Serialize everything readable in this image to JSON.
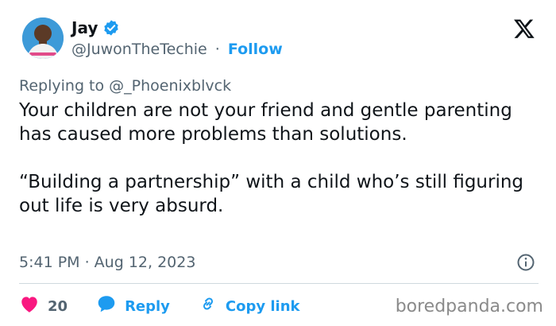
{
  "author": {
    "name": "Jay",
    "handle": "@JuwonTheTechie",
    "separator": "·",
    "follow_label": "Follow",
    "verified": true
  },
  "reply_context": {
    "prefix": "Replying to",
    "mention": "@_Phoenixblvck"
  },
  "tweet": {
    "paragraphs": [
      "Your children are not your friend and gentle parenting has caused more problems than solutions.",
      "“Building a partnership” with a child who’s still figuring out life is very absurd."
    ],
    "timestamp": "5:41 PM · Aug 12, 2023"
  },
  "actions": {
    "likes_count": "20",
    "reply_label": "Reply",
    "copy_link_label": "Copy link"
  },
  "watermark": "boredpanda.com",
  "icons": {
    "logo": "x-logo-icon",
    "verified": "verified-badge-icon",
    "info": "info-icon",
    "like": "heart-icon",
    "reply": "speech-bubble-icon",
    "link": "link-icon"
  },
  "colors": {
    "accent": "#1d9bf0",
    "like": "#f91880",
    "text": "#0f1419",
    "muted": "#536471",
    "divider": "#cfd9de"
  }
}
